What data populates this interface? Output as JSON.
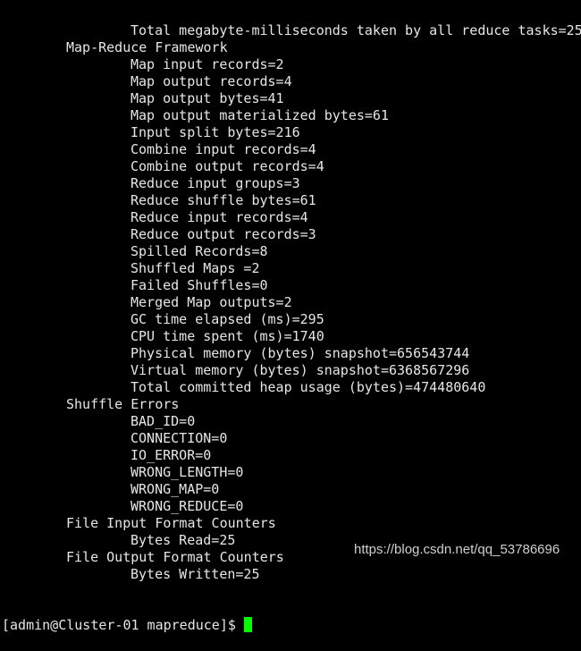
{
  "lines": [
    {
      "indent": 2,
      "text": "Total megabyte-milliseconds taken by all reduce tasks=25"
    },
    {
      "indent": 1,
      "text": "Map-Reduce Framework"
    },
    {
      "indent": 2,
      "text": "Map input records=2"
    },
    {
      "indent": 2,
      "text": "Map output records=4"
    },
    {
      "indent": 2,
      "text": "Map output bytes=41"
    },
    {
      "indent": 2,
      "text": "Map output materialized bytes=61"
    },
    {
      "indent": 2,
      "text": "Input split bytes=216"
    },
    {
      "indent": 2,
      "text": "Combine input records=4"
    },
    {
      "indent": 2,
      "text": "Combine output records=4"
    },
    {
      "indent": 2,
      "text": "Reduce input groups=3"
    },
    {
      "indent": 2,
      "text": "Reduce shuffle bytes=61"
    },
    {
      "indent": 2,
      "text": "Reduce input records=4"
    },
    {
      "indent": 2,
      "text": "Reduce output records=3"
    },
    {
      "indent": 2,
      "text": "Spilled Records=8"
    },
    {
      "indent": 2,
      "text": "Shuffled Maps =2"
    },
    {
      "indent": 2,
      "text": "Failed Shuffles=0"
    },
    {
      "indent": 2,
      "text": "Merged Map outputs=2"
    },
    {
      "indent": 2,
      "text": "GC time elapsed (ms)=295"
    },
    {
      "indent": 2,
      "text": "CPU time spent (ms)=1740"
    },
    {
      "indent": 2,
      "text": "Physical memory (bytes) snapshot=656543744"
    },
    {
      "indent": 2,
      "text": "Virtual memory (bytes) snapshot=6368567296"
    },
    {
      "indent": 2,
      "text": "Total committed heap usage (bytes)=474480640"
    },
    {
      "indent": 1,
      "text": "Shuffle Errors"
    },
    {
      "indent": 2,
      "text": "BAD_ID=0"
    },
    {
      "indent": 2,
      "text": "CONNECTION=0"
    },
    {
      "indent": 2,
      "text": "IO_ERROR=0"
    },
    {
      "indent": 2,
      "text": "WRONG_LENGTH=0"
    },
    {
      "indent": 2,
      "text": "WRONG_MAP=0"
    },
    {
      "indent": 2,
      "text": "WRONG_REDUCE=0"
    },
    {
      "indent": 1,
      "text": "File Input Format Counters"
    },
    {
      "indent": 2,
      "text": "Bytes Read=25"
    },
    {
      "indent": 1,
      "text": "File Output Format Counters"
    },
    {
      "indent": 2,
      "text": "Bytes Written=25"
    }
  ],
  "prompt": "[admin@Cluster-01 mapreduce]$ ",
  "cursor_color": "#00ff00",
  "watermark": "https://blog.csdn.net/qq_53786696"
}
